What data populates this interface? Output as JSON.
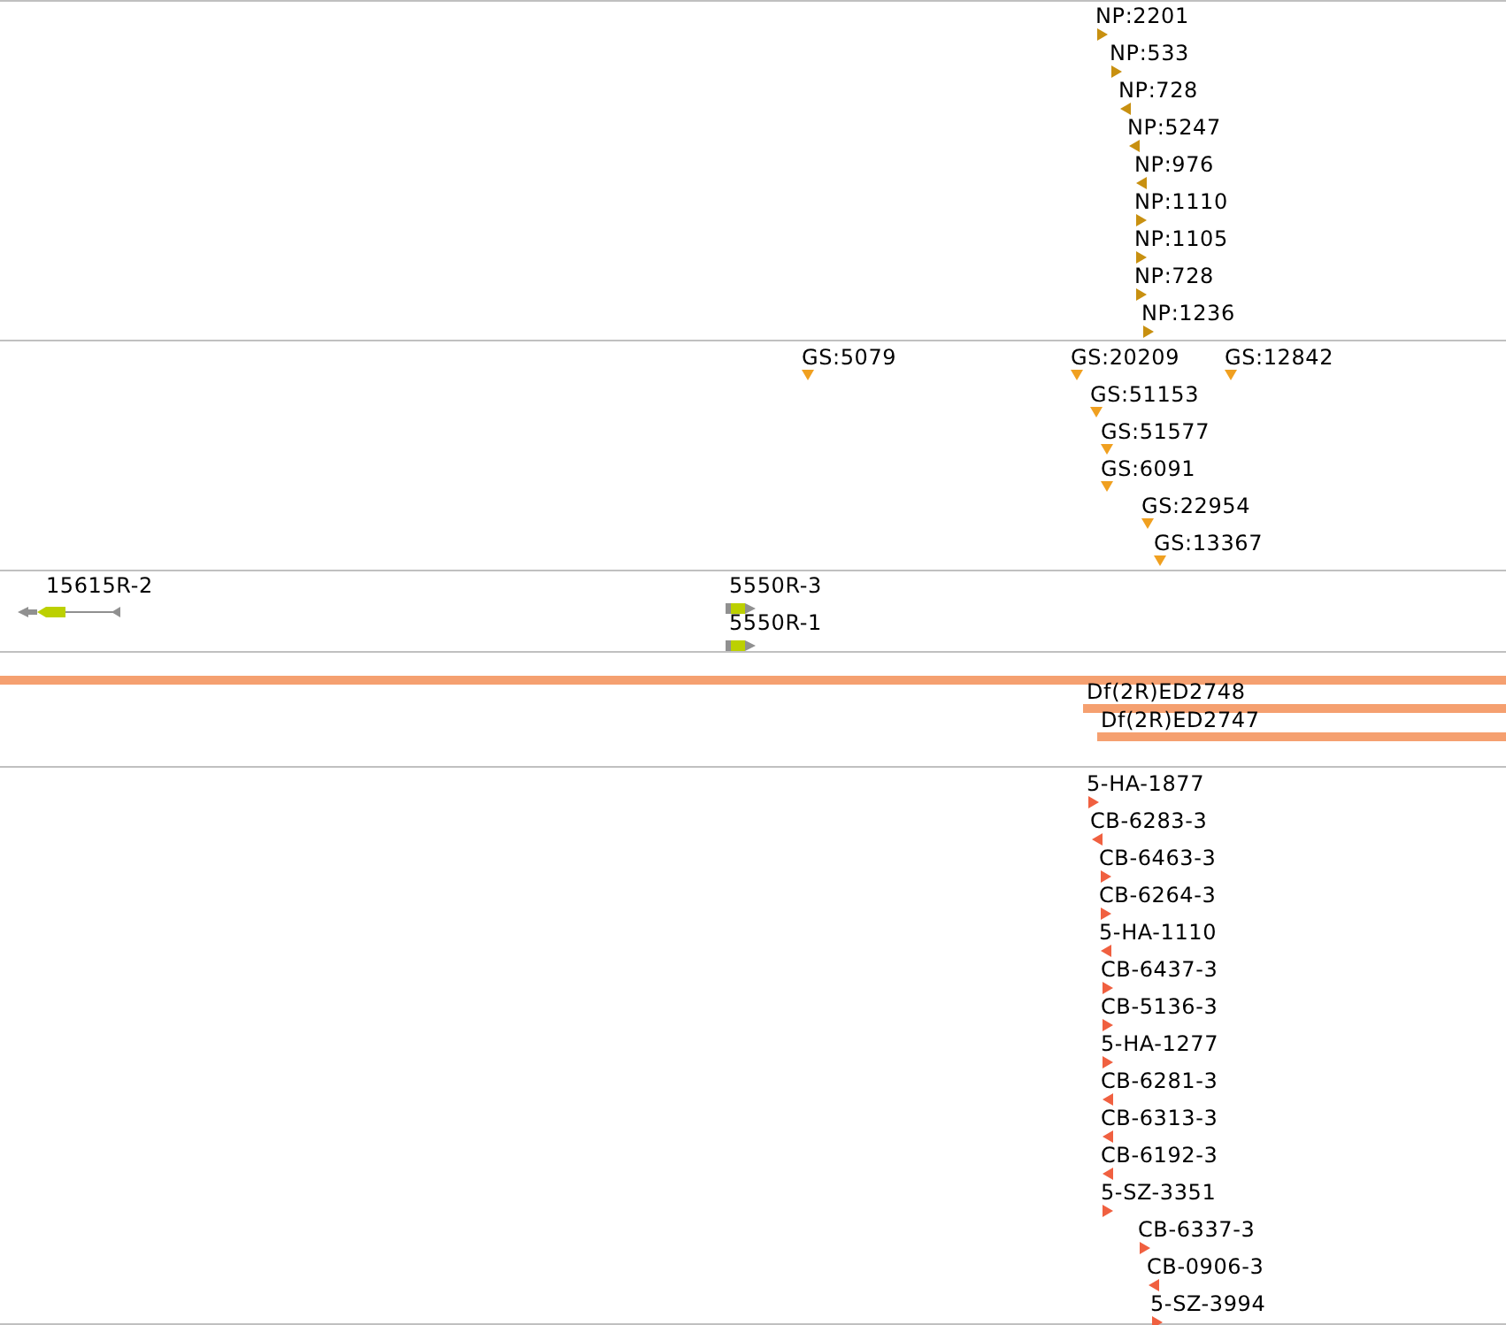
{
  "tracks": [
    {
      "kind": "marker",
      "features": [
        {
          "label": "NP:2201",
          "reverse": false
        },
        {
          "label": "NP:533",
          "reverse": false
        },
        {
          "label": "NP:728",
          "reverse": true
        },
        {
          "label": "NP:5247",
          "reverse": true
        },
        {
          "label": "NP:976",
          "reverse": true
        },
        {
          "label": "NP:1110",
          "reverse": false
        },
        {
          "label": "NP:1105",
          "reverse": false
        },
        {
          "label": "NP:728",
          "reverse": false
        },
        {
          "label": "NP:1236",
          "reverse": false
        }
      ]
    },
    {
      "kind": "insertion",
      "features": [
        {
          "label": "GS:5079"
        },
        {
          "label": "GS:20209"
        },
        {
          "label": "GS:12842"
        },
        {
          "label": "GS:51153"
        },
        {
          "label": "GS:51577"
        },
        {
          "label": "GS:6091"
        },
        {
          "label": "GS:22954"
        },
        {
          "label": "GS:13367"
        }
      ]
    },
    {
      "kind": "gene",
      "features": [
        {
          "label": "15615R-2",
          "reverse": true
        },
        {
          "label": "5550R-3",
          "reverse": false
        },
        {
          "label": "5550R-1",
          "reverse": false
        }
      ]
    },
    {
      "kind": "bar",
      "unlabelled_bar": true,
      "features": [
        {
          "label": "Df(2R)ED2748"
        },
        {
          "label": "Df(2R)ED2747"
        }
      ]
    },
    {
      "kind": "marker",
      "features": [
        {
          "label": "5-HA-1877",
          "reverse": false
        },
        {
          "label": "CB-6283-3",
          "reverse": true
        },
        {
          "label": "CB-6463-3",
          "reverse": false
        },
        {
          "label": "CB-6264-3",
          "reverse": false
        },
        {
          "label": "5-HA-1110",
          "reverse": true
        },
        {
          "label": "CB-6437-3",
          "reverse": false
        },
        {
          "label": "CB-5136-3",
          "reverse": false
        },
        {
          "label": "5-HA-1277",
          "reverse": false
        },
        {
          "label": "CB-6281-3",
          "reverse": true
        },
        {
          "label": "CB-6313-3",
          "reverse": true
        },
        {
          "label": "CB-6192-3",
          "reverse": true
        },
        {
          "label": "5-SZ-3351",
          "reverse": false
        },
        {
          "label": "CB-6337-3",
          "reverse": false
        },
        {
          "label": "CB-0906-3",
          "reverse": true
        },
        {
          "label": "5-SZ-3994",
          "reverse": false
        }
      ]
    }
  ]
}
